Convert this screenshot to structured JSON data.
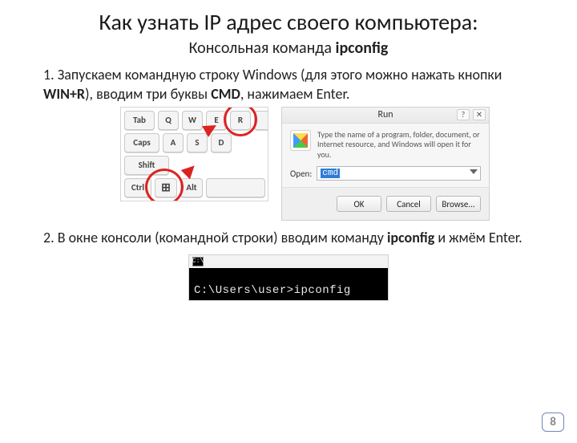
{
  "title": "Как узнать IP адрес своего компьютера:",
  "subtitle_pre": "Консольная команда ",
  "subtitle_cmd": "ipconfig",
  "step1": {
    "num": "1. ",
    "t1": "Запускаем командную строку Windows (для этого можно нажать кнопки ",
    "winr": "WIN+R",
    "t2": "), вводим три буквы ",
    "cmd": "CMD",
    "t3": ", нажимаем Enter."
  },
  "keyboard": {
    "keys": {
      "q": "Q",
      "w": "W",
      "e": "E",
      "r": "R",
      "tab": "Tab",
      "caps": "Caps",
      "shift": "Shift",
      "a": "A",
      "s": "S",
      "d": "D",
      "ctrl": "Ctrl",
      "alt": "Alt",
      "win": "⊞"
    }
  },
  "run": {
    "title": "Run",
    "desc": "Type the name of a program, folder, document, or Internet resource, and Windows will open it for you.",
    "open_label": "Open:",
    "typed": "cmd",
    "ok": "OK",
    "cancel": "Cancel",
    "browse": "Browse...",
    "help": "?",
    "close": "✕"
  },
  "step2": {
    "num": "2. ",
    "t1": "В окне консоли (командной строки) вводим команду ",
    "cmd": "ipconfig",
    "t2": " и жмём Enter."
  },
  "console": {
    "icon": "C:\\",
    "prompt": "C:\\Users\\user>ipconfig"
  },
  "page_number": "8"
}
